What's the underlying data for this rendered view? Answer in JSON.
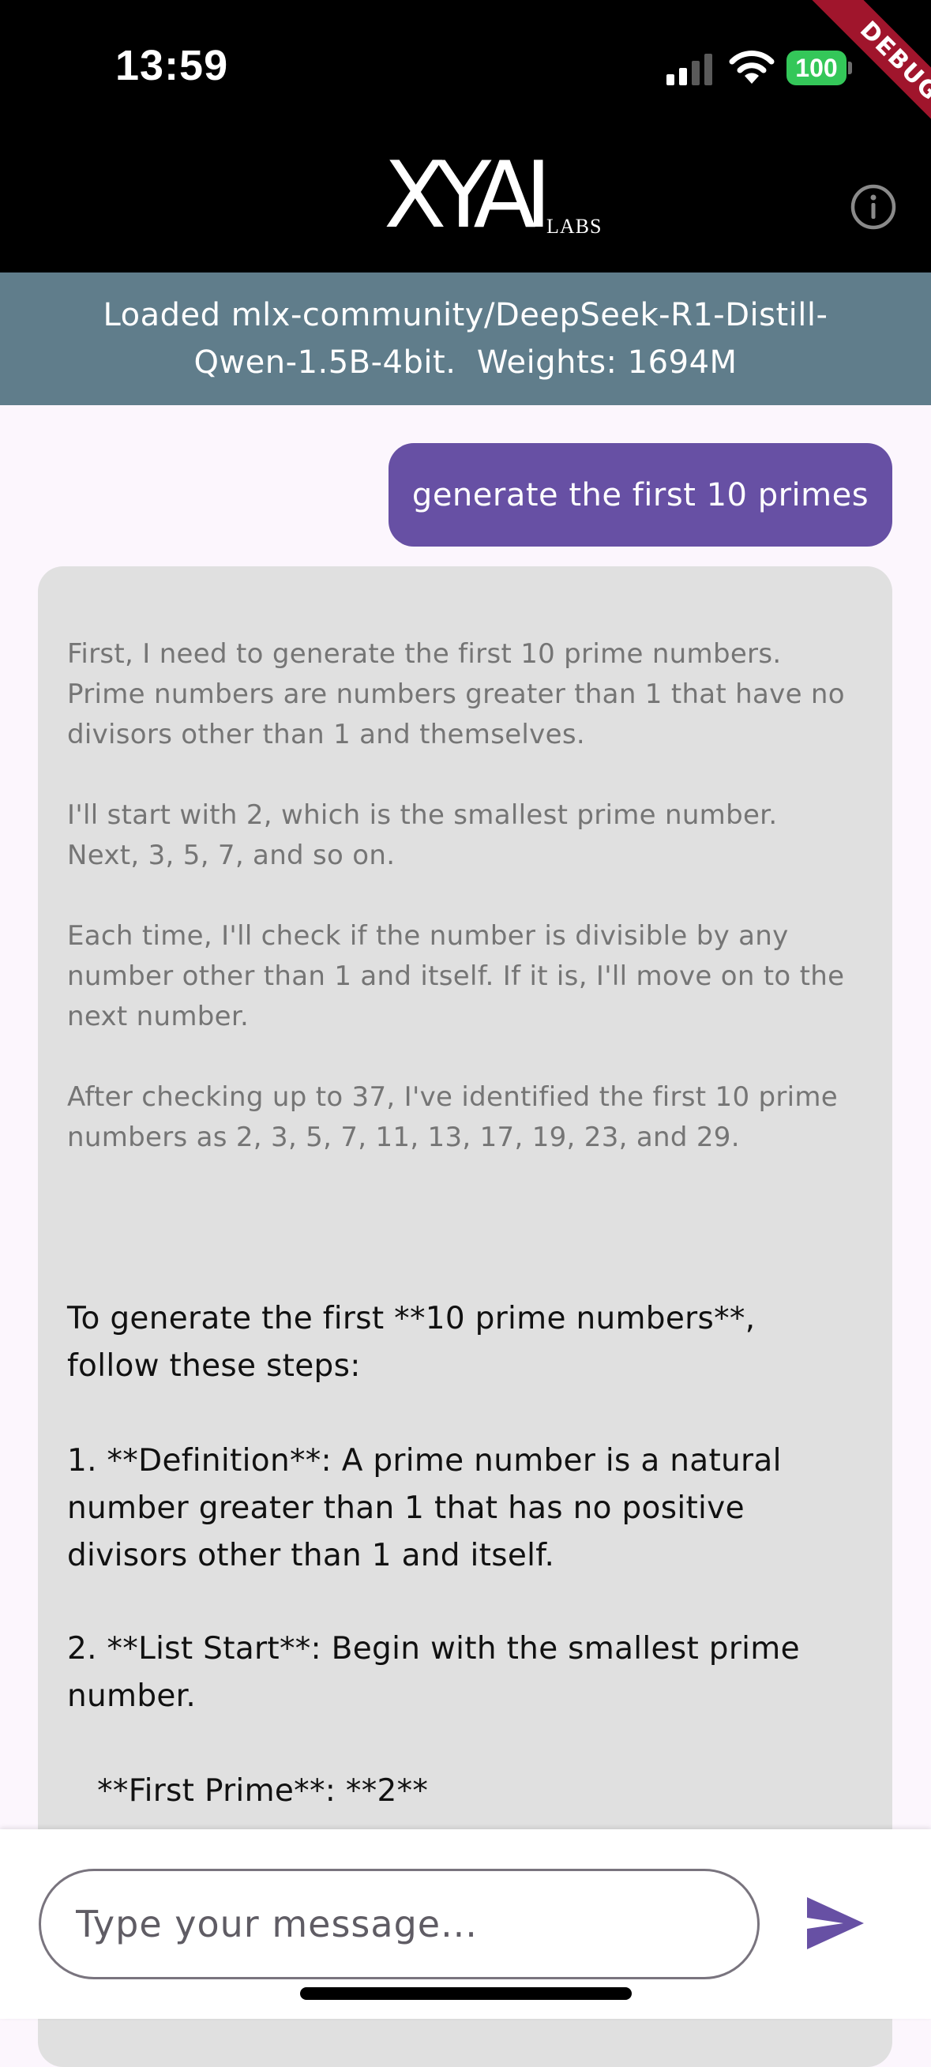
{
  "status_bar": {
    "time": "13:59",
    "battery_level": "100",
    "debug_banner": "DEBUG"
  },
  "header": {
    "logo_main": "XYAI",
    "logo_sub": "LABS",
    "info_icon": "info-icon"
  },
  "model_banner": {
    "text": "Loaded mlx-community/DeepSeek-R1-Distill-\nQwen-1.5B-4bit.  Weights: 1694M"
  },
  "messages": {
    "user": {
      "text": "generate the first 10 primes"
    },
    "assistant": {
      "thinking": [
        "First, I need to generate the first 10 prime numbers.\nPrime numbers are numbers greater than 1 that have no\ndivisors other than 1 and themselves.",
        "I'll start with 2, which is the smallest prime number.\nNext, 3, 5, 7, and so on.",
        "Each time, I'll check if the number is divisible by any\nnumber other than 1 and itself. If it is, I'll move on to the\nnext number.",
        "After checking up to 37, I've identified the first 10 prime\nnumbers as 2, 3, 5, 7, 11, 13, 17, 19, 23, and 29."
      ],
      "answer": [
        "To generate the first **10 prime numbers**,\nfollow these steps:",
        "1. **Definition**: A prime number is a natural\nnumber greater than 1 that has no positive\ndivisors other than 1 and itself.",
        "2. **List Start**: Begin with the smallest prime\nnumber.",
        "   **First Prime**: **2**"
      ]
    }
  },
  "composer": {
    "placeholder": "Type your message...",
    "value": "",
    "send_icon": "send-icon"
  },
  "colors": {
    "header_bg": "#000000",
    "banner_bg": "#607d8b",
    "user_bubble": "#6750a4",
    "assistant_bubble": "#e0e0e0",
    "page_bg": "#fcf6fd",
    "send_icon": "#6750a4",
    "battery": "#34c759",
    "debug_ribbon": "#a0152c"
  }
}
